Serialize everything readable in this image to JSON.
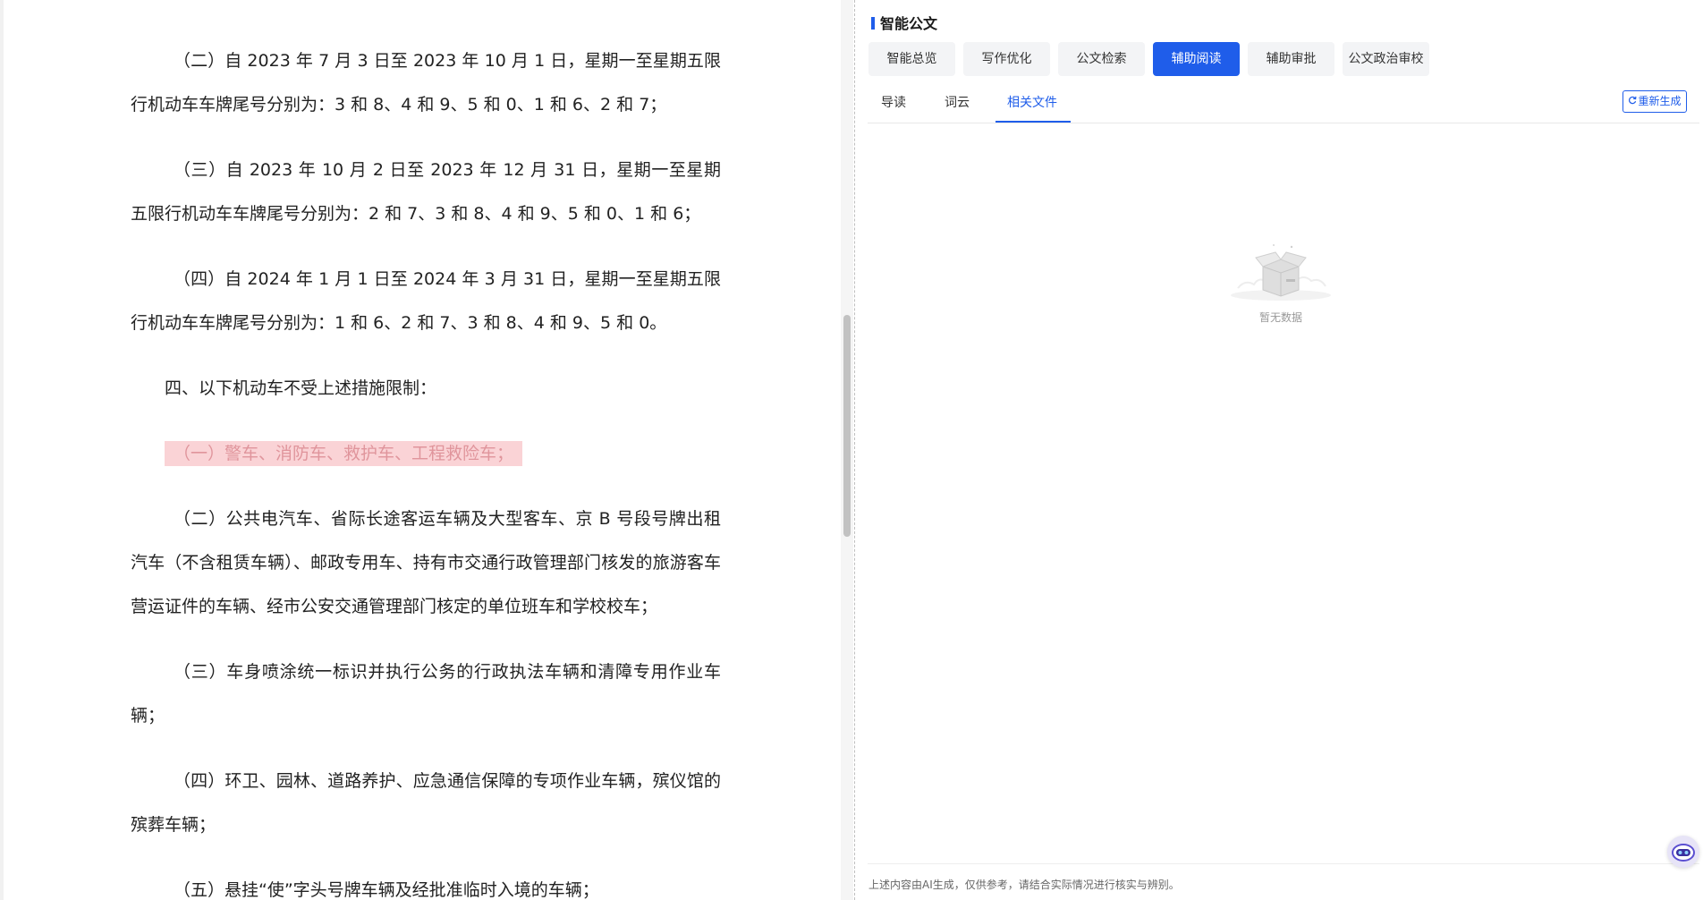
{
  "document": {
    "paragraphs": [
      "（二）自 2023 年 7 月 3 日至 2023 年 10 月 1 日，星期一至星期五限行机动车车牌尾号分别为：3 和 8、4 和 9、5 和 0、1 和 6、2 和 7；",
      "（三）自 2023 年 10 月 2 日至 2023 年 12 月 31 日，星期一至星期五限行机动车车牌尾号分别为：2 和 7、3 和 8、4 和 9、5 和 0、1 和 6；",
      "（四）自 2024 年 1 月 1 日至 2024 年 3 月 31 日，星期一至星期五限行机动车车牌尾号分别为：1 和 6、2 和 7、3 和 8、4 和 9、5 和 0。",
      "四、以下机动车不受上述措施限制：",
      "（一）警车、消防车、救护车、工程救险车；",
      "（二）公共电汽车、省际长途客运车辆及大型客车、京 B 号段号牌出租汽车（不含租赁车辆）、邮政专用车、持有市交通行政管理部门核发的旅游客车营运证件的车辆、经市公安交通管理部门核定的单位班车和学校校车；",
      "（三）车身喷涂统一标识并执行公务的行政执法车辆和清障专用作业车辆；",
      "（四）环卫、园林、道路养护、应急通信保障的专项作业车辆，殡仪馆的殡葬车辆；",
      "（五）悬挂“使”字头号牌车辆及经批准临时入境的车辆；"
    ]
  },
  "panel": {
    "title": "智能公文",
    "function_tabs": [
      "智能总览",
      "写作优化",
      "公文检索",
      "辅助阅读",
      "辅助审批",
      "公文政治审校"
    ],
    "active_function_tab": "辅助阅读",
    "sub_tabs": [
      "导读",
      "词云",
      "相关文件"
    ],
    "active_sub_tab": "相关文件",
    "regenerate_label": "重新生成",
    "empty_text": "暂无数据",
    "disclaimer": "上述内容由AI生成，仅供参考，请结合实际情况进行核实与辨别。"
  },
  "colors": {
    "accent": "#1f5dea",
    "highlight_bg": "#fad3d6",
    "highlight_text": "#e0959c"
  },
  "icons": [
    "refresh-icon",
    "empty-box-icon",
    "assistant-robot-icon"
  ]
}
